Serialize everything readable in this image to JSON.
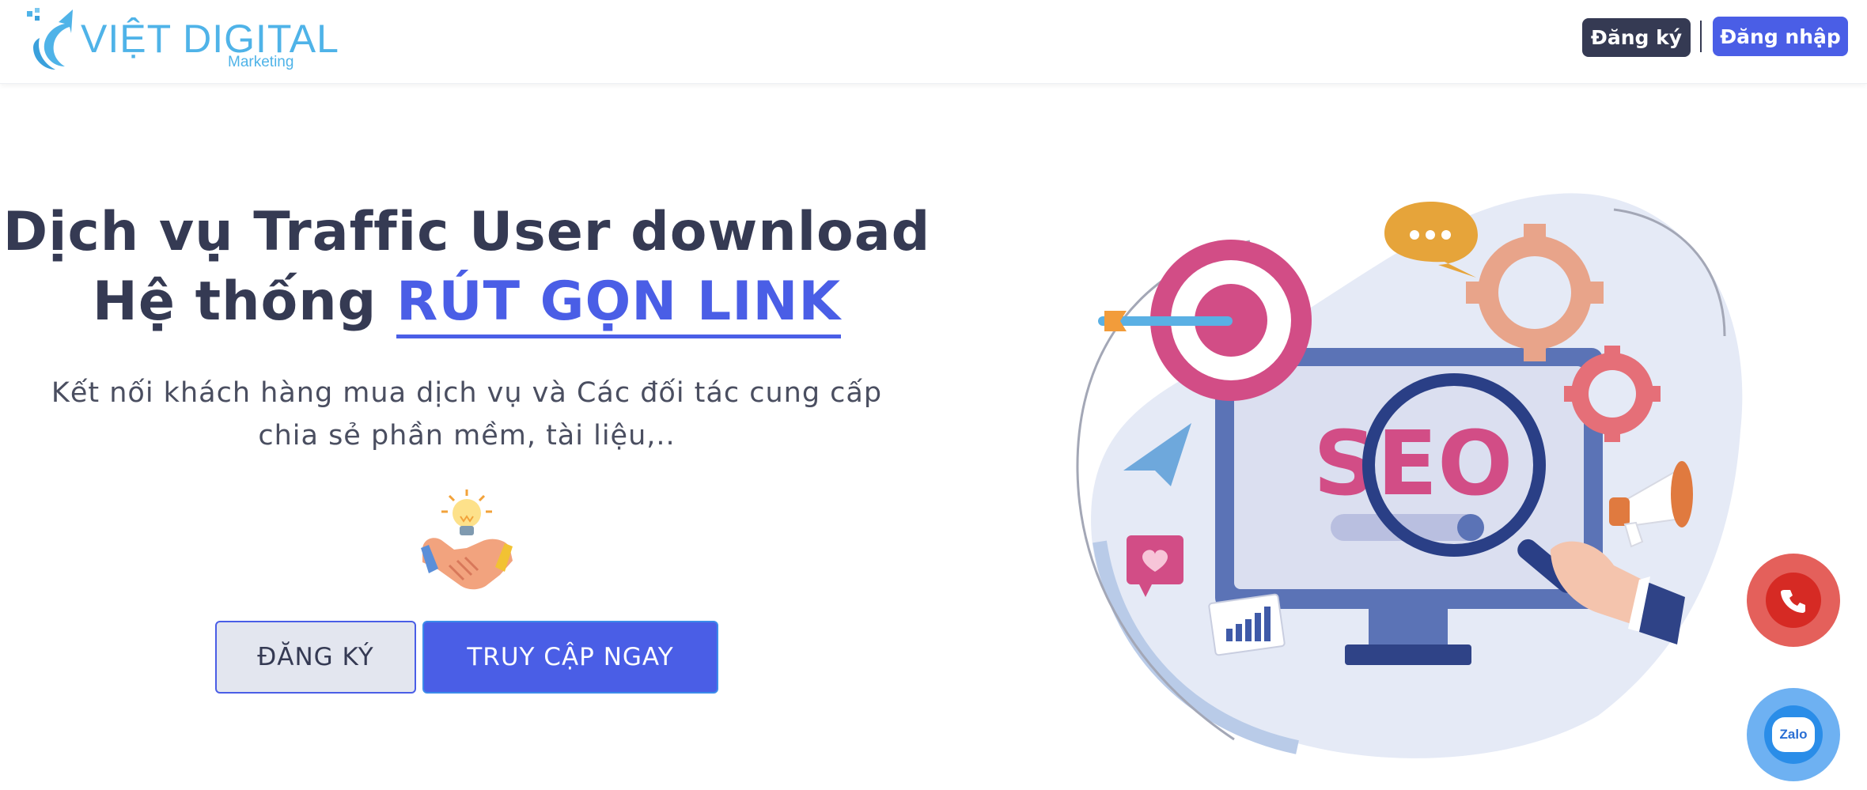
{
  "header": {
    "logo": {
      "title": "VIỆT DIGITAL",
      "subtitle": "Marketing"
    },
    "register_label": "Đăng ký",
    "login_label": "Đăng nhập"
  },
  "hero": {
    "title_line1": "Dịch vụ Traffic User download",
    "title_line2_prefix": "Hệ thống ",
    "title_line2_highlight": "RÚT GỌN LINK",
    "subtitle_line1": "Kết nối khách hàng mua dịch vụ và Các đối tác cung cấp",
    "subtitle_line2": "chia sẻ phần mềm, tài liệu,..",
    "register_button": "ĐĂNG KÝ",
    "access_button": "TRUY CẬP NGAY"
  },
  "illustration": {
    "screen_text": "SEO"
  },
  "floating": {
    "zalo_label": "Zalo"
  },
  "colors": {
    "primary": "#4a5ee6",
    "dark": "#353a53",
    "logo": "#4fb3e8",
    "seo_pink": "#d24d86",
    "phone_red": "#e4605b"
  }
}
